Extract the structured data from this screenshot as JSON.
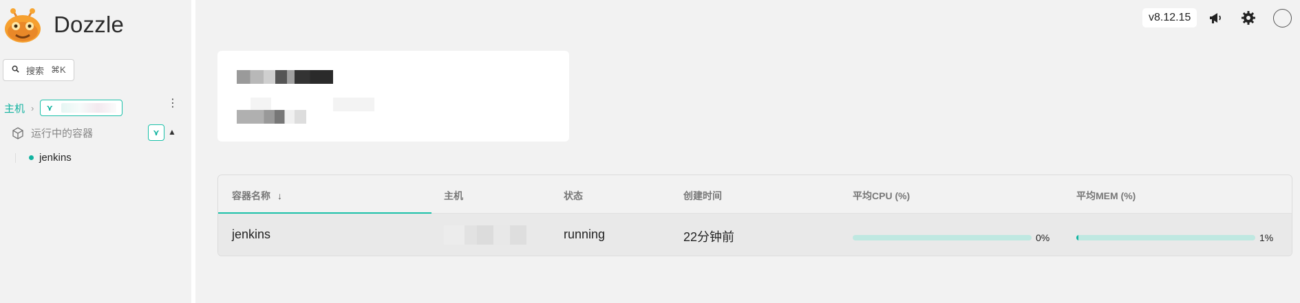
{
  "brand": {
    "name": "Dozzle"
  },
  "search": {
    "label": "搜索",
    "shortcut": "⌘K"
  },
  "sidebar": {
    "host_label": "主机",
    "containers_label": "运行中的容器",
    "containers": [
      {
        "name": "jenkins",
        "status": "running"
      }
    ]
  },
  "header": {
    "version": "v8.12.15"
  },
  "table": {
    "columns": [
      "容器名称",
      "主机",
      "状态",
      "创建时间",
      "平均CPU (%)",
      "平均MEM (%)"
    ],
    "sort_column": "容器名称",
    "rows": [
      {
        "name": "jenkins",
        "state": "running",
        "created": "22分钟前",
        "cpu": 0,
        "cpu_label": "0%",
        "mem": 1,
        "mem_label": "1%"
      }
    ]
  },
  "colors": {
    "accent": "#12b3a0",
    "accent_light": "#bfe8e1",
    "background": "#f2f2f2"
  },
  "icons": [
    "dozzle-logo-icon",
    "search-icon",
    "chevron-right-icon",
    "filter-icon",
    "kebab-menu-icon",
    "cube-icon",
    "chevron-up-icon",
    "megaphone-icon",
    "gear-icon",
    "sort-arrow-icon"
  ]
}
